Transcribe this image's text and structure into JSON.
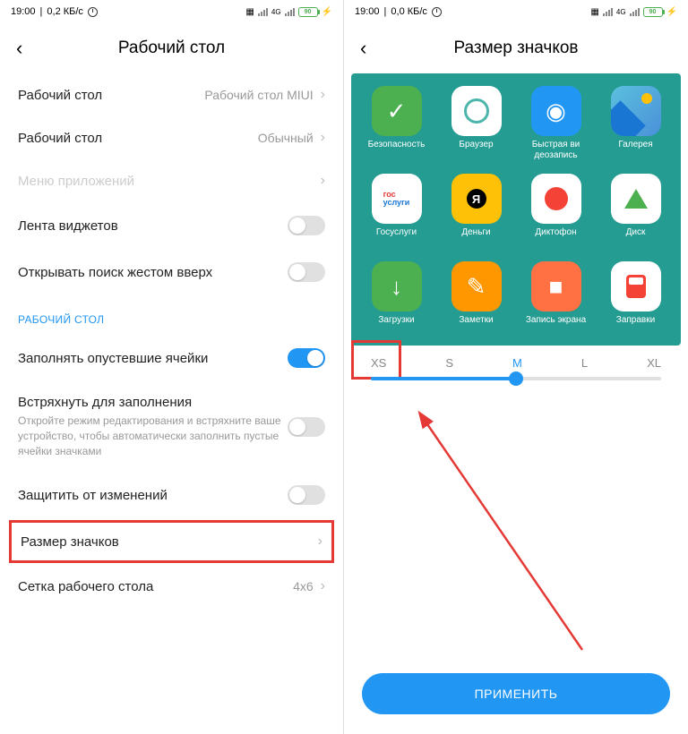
{
  "left": {
    "status": {
      "time": "19:00",
      "speed": "0,2 КБ/с",
      "battery": "90"
    },
    "title": "Рабочий стол",
    "rows": [
      {
        "label": "Рабочий стол",
        "value": "Рабочий стол MIUI",
        "chev": true
      },
      {
        "label": "Рабочий стол",
        "value": "Обычный",
        "chev": true
      },
      {
        "label": "Меню приложений",
        "chev": true,
        "disabled": true
      },
      {
        "label": "Лента виджетов",
        "toggle": false
      },
      {
        "label": "Открывать поиск жестом вверх",
        "toggle": false
      }
    ],
    "section": "РАБОЧИЙ СТОЛ",
    "rows2": [
      {
        "label": "Заполнять опустевшие ячейки",
        "toggle": true
      },
      {
        "label": "Встряхнуть для заполнения",
        "sub": "Откройте режим редактирования и встряхните ваше устройство, чтобы автоматически заполнить пустые ячейки значками",
        "toggle": false
      },
      {
        "label": "Защитить от изменений",
        "toggle": false
      },
      {
        "label": "Размер значков",
        "chev": true,
        "highlight": true
      },
      {
        "label": "Сетка рабочего стола",
        "value": "4x6",
        "chev": true
      }
    ]
  },
  "right": {
    "status": {
      "time": "19:00",
      "speed": "0,0 КБ/с",
      "battery": "90"
    },
    "title": "Размер значков",
    "apps": [
      {
        "name": "Безопасность",
        "cls": "i-safety",
        "glyph": "✓"
      },
      {
        "name": "Браузер",
        "cls": "i-browser"
      },
      {
        "name": "Быстрая ви деозапись",
        "cls": "i-video",
        "glyph": "◉"
      },
      {
        "name": "Галерея",
        "cls": "i-gallery"
      },
      {
        "name": "Госуслуги",
        "cls": "i-gos"
      },
      {
        "name": "Деньги",
        "cls": "i-money"
      },
      {
        "name": "Диктофон",
        "cls": "i-dict"
      },
      {
        "name": "Диск",
        "cls": "i-disk"
      },
      {
        "name": "Загрузки",
        "cls": "i-down",
        "glyph": "↓"
      },
      {
        "name": "Заметки",
        "cls": "i-notes",
        "glyph": "✎"
      },
      {
        "name": "Запись экрана",
        "cls": "i-rec",
        "glyph": "■"
      },
      {
        "name": "Заправки",
        "cls": "i-fuel"
      }
    ],
    "sizes": [
      "XS",
      "S",
      "M",
      "L",
      "XL"
    ],
    "selected": "M",
    "apply": "ПРИМЕНИТЬ"
  },
  "net": "4G"
}
